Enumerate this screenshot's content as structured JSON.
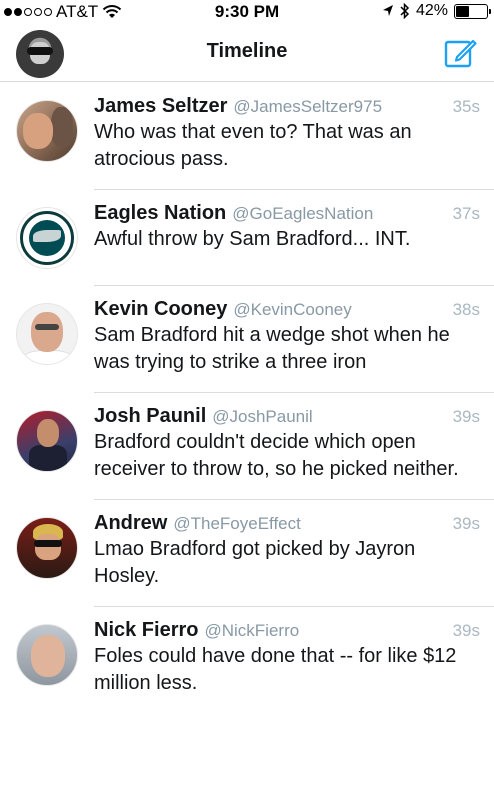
{
  "status_bar": {
    "carrier": "AT&T",
    "time": "9:30 PM",
    "battery": "42%",
    "battery_level": 0.42
  },
  "nav": {
    "title": "Timeline"
  },
  "tweets": [
    {
      "name": "James Seltzer",
      "handle": "@JamesSeltzer975",
      "time": "35s",
      "text": "Who was that even to? That was an atrocious pass."
    },
    {
      "name": "Eagles Nation",
      "handle": "@GoEaglesNation",
      "time": "37s",
      "text": "Awful throw by Sam Bradford... INT."
    },
    {
      "name": "Kevin Cooney",
      "handle": "@KevinCooney",
      "time": "38s",
      "text": "Sam Bradford hit a wedge shot when he was trying to strike a three iron"
    },
    {
      "name": "Josh Paunil",
      "handle": "@JoshPaunil",
      "time": "39s",
      "text": "Bradford couldn't decide which open receiver to throw to, so he picked neither."
    },
    {
      "name": "Andrew",
      "handle": "@TheFoyeEffect",
      "time": "39s",
      "text": "Lmao Bradford got picked by Jayron Hosley."
    },
    {
      "name": "Nick Fierro",
      "handle": "@NickFierro",
      "time": "39s",
      "text": "Foles could have done that -- for like $12 million less."
    }
  ],
  "colors": {
    "accent": "#1da1f2",
    "handle": "#8899a6",
    "timestamp": "#aab8c2",
    "divider": "#dcdcdc"
  }
}
